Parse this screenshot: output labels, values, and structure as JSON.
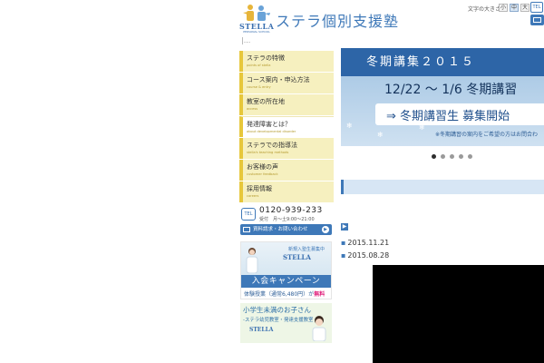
{
  "header": {
    "logo_word": "STELLA",
    "logo_sub": "PERSONAL SCHOOL",
    "site_title": "ステラ個別支援塾",
    "breadcrumb": "|...",
    "font_size_label": "文字の大きさ",
    "font_sizes": [
      "小",
      "中",
      "大"
    ],
    "tel_label": "TEL"
  },
  "nav": [
    {
      "jp": "ステラの特徴",
      "en": "points of stella"
    },
    {
      "jp": "コース案内・申込方法",
      "en": "course & entry"
    },
    {
      "jp": "教室の所在地",
      "en": "access"
    },
    {
      "jp": "発達障害とは？",
      "en": "about developmental disorder"
    },
    {
      "jp": "ステラでの指導法",
      "en": "stella's teaching methods"
    },
    {
      "jp": "お客様の声",
      "en": "customer feedback"
    },
    {
      "jp": "採用情報",
      "en": "careers"
    }
  ],
  "contact": {
    "tel_icon": "TEL",
    "number": "0120-939-233",
    "hours": "受付　月〜土9:00〜21:00",
    "button_label": "資料請求・お問い合わせ"
  },
  "banner1": {
    "new_students": "新規入塾生募集中",
    "brand": "STELLA",
    "campaign": "入会キャンペーン",
    "trial": "体験授業（通常6,480円）が",
    "free": "無料"
  },
  "banner2": {
    "line1": "小学生未満のお子さん",
    "line2": "-ステラ幼児教室・発達支援教室",
    "brand": "STELLA"
  },
  "slider": {
    "headline": "冬期講集２０１５",
    "dates": "12/22 〜 1/6 冬期講習",
    "recruit": "⇒ 冬期講習生 募集開始",
    "note": "※冬期講習の案内をご希望の方はお問合わ",
    "dots_total": 5,
    "active_dot": 1
  },
  "news": [
    {
      "date": "2015.11.21"
    },
    {
      "date": "2015.08.28"
    }
  ],
  "colors": {
    "brand_blue": "#3e78b8",
    "nav_bg": "#f6f0bf",
    "nav_accent": "#e7c73b"
  }
}
